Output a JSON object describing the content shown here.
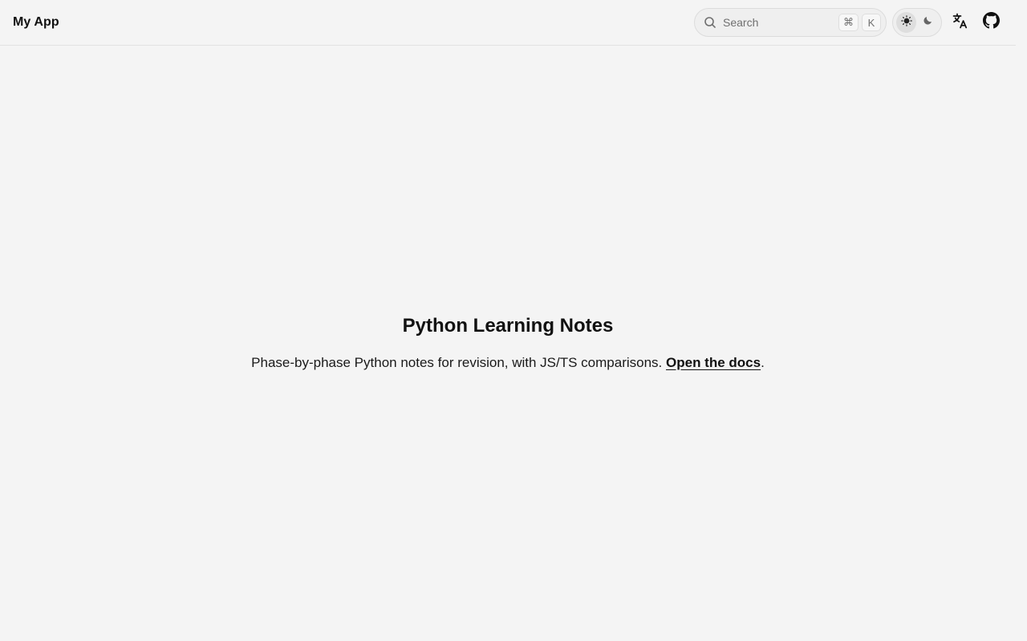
{
  "app": {
    "title": "My App"
  },
  "search": {
    "placeholder": "Search",
    "shortcut_mod": "⌘",
    "shortcut_key": "K"
  },
  "theme": {
    "options": [
      "sun-icon",
      "moon-icon"
    ],
    "active": "light"
  },
  "nav_icons": {
    "language": "translate-icon",
    "repo": "github-icon"
  },
  "hero": {
    "title": "Python Learning Notes",
    "subtitle": "Phase-by-phase Python notes for revision, with JS/TS comparisons.",
    "link_label": "Open the docs",
    "trailing": "."
  },
  "colors": {
    "background": "#f4f4f4",
    "text": "#111111",
    "border": "#e2e2e2"
  }
}
